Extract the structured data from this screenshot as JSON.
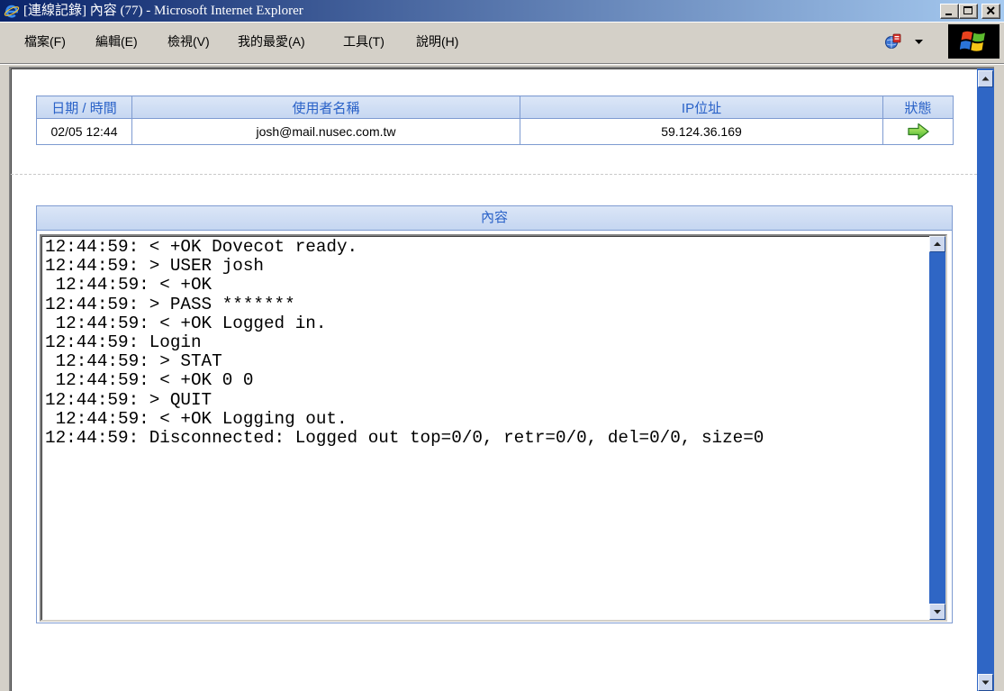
{
  "window": {
    "title": "[連線記錄] 內容 (77) - Microsoft Internet Explorer",
    "icon": "internet-explorer-icon",
    "controls": [
      "minimize-icon",
      "maximize-icon",
      "close-icon"
    ]
  },
  "menu": {
    "items": [
      {
        "label": "檔案(F)"
      },
      {
        "label": "編輯(E)"
      },
      {
        "label": "檢視(V)"
      },
      {
        "label": "我的最愛(A)"
      },
      {
        "label": "工具(T)"
      },
      {
        "label": "說明(H)"
      }
    ],
    "tool_icon": "language-tool-icon",
    "tool_dropdown_icon": "chevron-down-icon",
    "throbber_icon": "windows-logo-icon"
  },
  "session_table": {
    "headers": {
      "datetime": "日期 / 時間",
      "username": "使用者名稱",
      "ip": "IP位址",
      "status": "狀態"
    },
    "rows": [
      {
        "datetime": "02/05 12:44",
        "username": "josh@mail.nusec.com.tw",
        "ip": "59.124.36.169",
        "status_icon": "green-right-arrow-icon"
      }
    ]
  },
  "content_panel": {
    "title": "內容",
    "log_lines": [
      "12:44:59: < +OK Dovecot ready.",
      "12:44:59: > USER josh",
      " 12:44:59: < +OK",
      "12:44:59: > PASS *******",
      " 12:44:59: < +OK Logged in.",
      "12:44:59: Login",
      " 12:44:59: > STAT",
      " 12:44:59: < +OK 0 0",
      "12:44:59: > QUIT",
      " 12:44:59: < +OK Logging out.",
      "12:44:59: Disconnected: Logged out top=0/0, retr=0/0, del=0/0, size=0"
    ]
  },
  "scrollbars": {
    "up_icon": "arrow-up-icon",
    "down_icon": "arrow-down-icon"
  },
  "colors": {
    "title_bar_start": "#0a246a",
    "title_bar_end": "#a6caf0",
    "window_frame": "#d4d0c8",
    "table_header_bg": "#c5d6f1",
    "table_header_text": "#2a62c8",
    "table_border": "#7e9bd1",
    "scrollbar_track": "#2f66c5",
    "scrollbar_button": "#cdd8ee",
    "divider": "#c9c9c9"
  }
}
